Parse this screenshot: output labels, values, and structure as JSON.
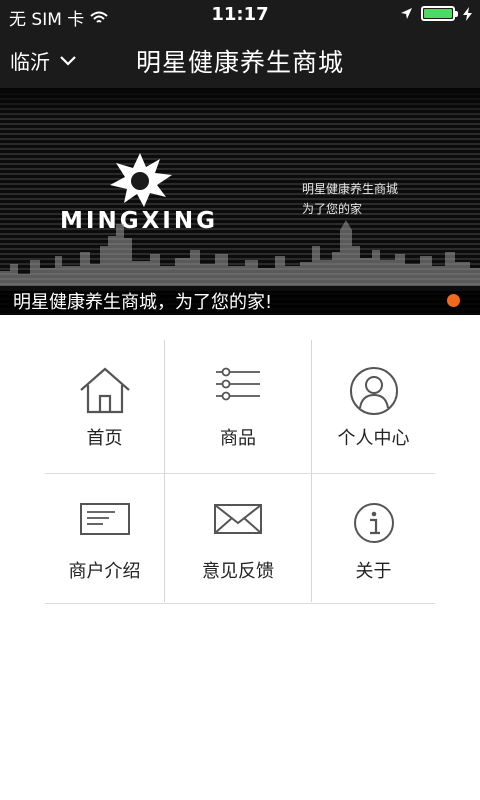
{
  "status_bar": {
    "carrier": "无 SIM 卡",
    "time": "11:17",
    "battery_level": 1.0,
    "battery_color": "#4cd964"
  },
  "nav": {
    "city": "临沂",
    "title": "明星健康养生商城"
  },
  "banner": {
    "logo_text": "MINGXING",
    "tagline_1": "明星健康养生商城",
    "tagline_2": "为了您的家",
    "caption": "明星健康养生商城，为了您的家!",
    "indicator_color": "#f26a1b"
  },
  "menu": [
    {
      "label": "首页",
      "icon": "home-icon"
    },
    {
      "label": "商品",
      "icon": "list-icon"
    },
    {
      "label": "个人中心",
      "icon": "user-icon"
    },
    {
      "label": "商户介绍",
      "icon": "card-icon"
    },
    {
      "label": "意见反馈",
      "icon": "mail-icon"
    },
    {
      "label": "关于",
      "icon": "info-icon"
    }
  ],
  "colors": {
    "bar_background": "#1b1b1b",
    "accent": "#f26a1b",
    "icon_stroke": "#555555"
  }
}
